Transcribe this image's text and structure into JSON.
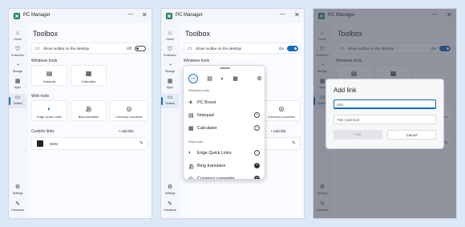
{
  "app": {
    "title": "PC Manager"
  },
  "nav": [
    {
      "label": "Home",
      "icon": "home-icon",
      "glyph": "⌂"
    },
    {
      "label": "Protection",
      "icon": "shield-icon",
      "glyph": "⛉"
    },
    {
      "label": "Storage",
      "icon": "storage-icon",
      "glyph": "◔"
    },
    {
      "label": "Apps",
      "icon": "apps-icon",
      "glyph": "▦"
    },
    {
      "label": "Toolbox",
      "icon": "toolbox-icon",
      "glyph": "▭"
    }
  ],
  "nav_bottom": [
    {
      "label": "Settings",
      "icon": "gear-icon",
      "glyph": "⚙"
    },
    {
      "label": "Feedback",
      "icon": "feedback-icon",
      "glyph": "✎"
    }
  ],
  "toolbox": {
    "title": "Toolbox",
    "show_toolbar_label": "Show toolbar on the desktop",
    "toggle_off": "Off",
    "toggle_on": "On",
    "windows_tools": "Windows tools",
    "notepad": "Notepad",
    "calculator": "Calculator",
    "web_tools": "Web tools",
    "edge_quick_links": "Edge Quick Links",
    "bing_translator": "Bing translator",
    "currency_converter": "Currency converter",
    "custom_links": "Custom links",
    "add_link": "+ Add link",
    "msn": "MSN"
  },
  "popup": {
    "boost_badge": "0%",
    "windows_tools": "Windows tools",
    "web_tools": "Web tools",
    "items_windows": [
      {
        "label": "PC Boost",
        "icon": "rocket-icon",
        "glyph": "✈",
        "action": ""
      },
      {
        "label": "Notepad",
        "icon": "notepad-icon",
        "glyph": "▤",
        "action": "−"
      },
      {
        "label": "Calculator",
        "icon": "calculator-icon",
        "glyph": "▦",
        "action": "−"
      }
    ],
    "items_web": [
      {
        "label": "Edge Quick Links",
        "icon": "edge-icon",
        "glyph": "◐",
        "action": "−"
      },
      {
        "label": "Bing translator",
        "icon": "translate-icon",
        "glyph": "あ",
        "action": "+"
      },
      {
        "label": "Currency converter",
        "icon": "currency-icon",
        "glyph": "◎",
        "action": "+"
      }
    ]
  },
  "dialog": {
    "title": "Add link",
    "url_placeholder": "URL",
    "title_placeholder": "Title (optional)",
    "add_label": "Add",
    "cancel_label": "Cancel"
  },
  "colors": {
    "accent": "#0f6cbd",
    "background": "#dde8f7"
  }
}
